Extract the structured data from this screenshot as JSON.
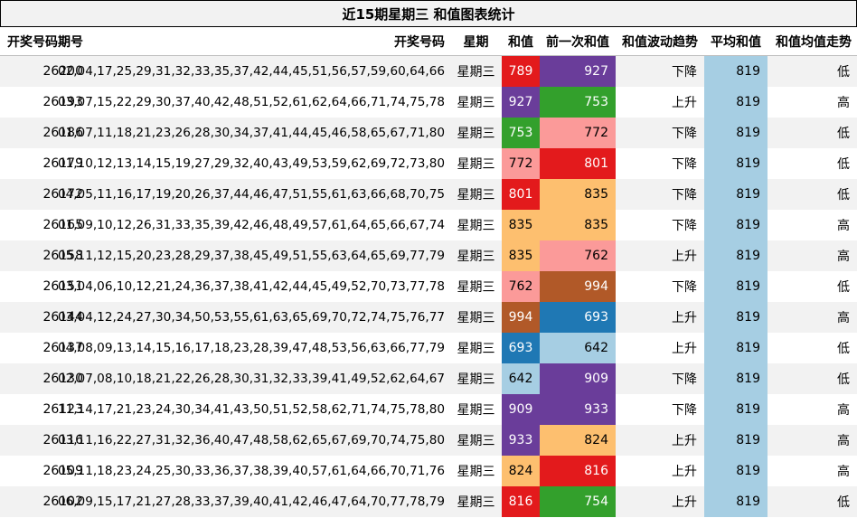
{
  "title": "近15期星期三 和值图表统计",
  "headers": {
    "issue": "开奖号码期号",
    "numbers": "开奖号码",
    "day": "星期",
    "sum": "和值",
    "prev_sum": "前一次和值",
    "trend": "和值波动趋势",
    "avg": "平均和值",
    "avg_trend": "和值均值走势"
  },
  "colors": {
    "789": "#e31a1c",
    "927": "#6a3d9a",
    "753": "#33a02c",
    "772": "#fb9a99",
    "801": "#e31a1c",
    "835": "#fdbf6f",
    "762": "#fb9a99",
    "994": "#b15928",
    "693": "#1f78b4",
    "642": "#a6cee3",
    "909": "#6a3d9a",
    "933": "#6a3d9a",
    "824": "#fdbf6f",
    "816": "#e31a1c",
    "754": "#33a02c",
    "avg_bg": "#a6cee3",
    "row_alt": "#f2f2f2"
  },
  "rows": [
    {
      "issue": "26200",
      "numbers": "02,04,17,25,29,31,32,33,35,37,42,44,45,51,56,57,59,60,64,66",
      "day": "星期三",
      "sum": "789",
      "prev_sum": "927",
      "trend": "下降",
      "avg": "819",
      "avg_trend": "低"
    },
    {
      "issue": "26193",
      "numbers": "03,07,15,22,29,30,37,40,42,48,51,52,61,62,64,66,71,74,75,78",
      "day": "星期三",
      "sum": "927",
      "prev_sum": "753",
      "trend": "上升",
      "avg": "819",
      "avg_trend": "高"
    },
    {
      "issue": "26186",
      "numbers": "01,07,11,18,21,23,26,28,30,34,37,41,44,45,46,58,65,67,71,80",
      "day": "星期三",
      "sum": "753",
      "prev_sum": "772",
      "trend": "下降",
      "avg": "819",
      "avg_trend": "低"
    },
    {
      "issue": "26179",
      "numbers": "01,10,12,13,14,15,19,27,29,32,40,43,49,53,59,62,69,72,73,80",
      "day": "星期三",
      "sum": "772",
      "prev_sum": "801",
      "trend": "下降",
      "avg": "819",
      "avg_trend": "低"
    },
    {
      "issue": "26172",
      "numbers": "04,05,11,16,17,19,20,26,37,44,46,47,51,55,61,63,66,68,70,75",
      "day": "星期三",
      "sum": "801",
      "prev_sum": "835",
      "trend": "下降",
      "avg": "819",
      "avg_trend": "低"
    },
    {
      "issue": "26165",
      "numbers": "01,09,10,12,26,31,33,35,39,42,46,48,49,57,61,64,65,66,67,74",
      "day": "星期三",
      "sum": "835",
      "prev_sum": "835",
      "trend": "下降",
      "avg": "819",
      "avg_trend": "高"
    },
    {
      "issue": "26158",
      "numbers": "05,11,12,15,20,23,28,29,37,38,45,49,51,55,63,64,65,69,77,79",
      "day": "星期三",
      "sum": "835",
      "prev_sum": "762",
      "trend": "上升",
      "avg": "819",
      "avg_trend": "高"
    },
    {
      "issue": "26151",
      "numbers": "03,04,06,10,12,21,24,36,37,38,41,42,44,45,49,52,70,73,77,78",
      "day": "星期三",
      "sum": "762",
      "prev_sum": "994",
      "trend": "下降",
      "avg": "819",
      "avg_trend": "低"
    },
    {
      "issue": "26144",
      "numbers": "03,04,12,24,27,30,34,50,53,55,61,63,65,69,70,72,74,75,76,77",
      "day": "星期三",
      "sum": "994",
      "prev_sum": "693",
      "trend": "上升",
      "avg": "819",
      "avg_trend": "高"
    },
    {
      "issue": "26137",
      "numbers": "04,08,09,13,14,15,16,17,18,23,28,39,47,48,53,56,63,66,77,79",
      "day": "星期三",
      "sum": "693",
      "prev_sum": "642",
      "trend": "上升",
      "avg": "819",
      "avg_trend": "低"
    },
    {
      "issue": "26130",
      "numbers": "02,07,08,10,18,21,22,26,28,30,31,32,33,39,41,49,52,62,64,67",
      "day": "星期三",
      "sum": "642",
      "prev_sum": "909",
      "trend": "下降",
      "avg": "819",
      "avg_trend": "低"
    },
    {
      "issue": "26123",
      "numbers": "11,14,17,21,23,24,30,34,41,43,50,51,52,58,62,71,74,75,78,80",
      "day": "星期三",
      "sum": "909",
      "prev_sum": "933",
      "trend": "下降",
      "avg": "819",
      "avg_trend": "高"
    },
    {
      "issue": "26116",
      "numbers": "03,11,16,22,27,31,32,36,40,47,48,58,62,65,67,69,70,74,75,80",
      "day": "星期三",
      "sum": "933",
      "prev_sum": "824",
      "trend": "上升",
      "avg": "819",
      "avg_trend": "高"
    },
    {
      "issue": "26109",
      "numbers": "05,11,18,23,24,25,30,33,36,37,38,39,40,57,61,64,66,70,71,76",
      "day": "星期三",
      "sum": "824",
      "prev_sum": "816",
      "trend": "上升",
      "avg": "819",
      "avg_trend": "高"
    },
    {
      "issue": "26102",
      "numbers": "06,09,15,17,21,27,28,33,37,39,40,41,42,46,47,64,70,77,78,79",
      "day": "星期三",
      "sum": "816",
      "prev_sum": "754",
      "trend": "上升",
      "avg": "819",
      "avg_trend": "低"
    }
  ]
}
